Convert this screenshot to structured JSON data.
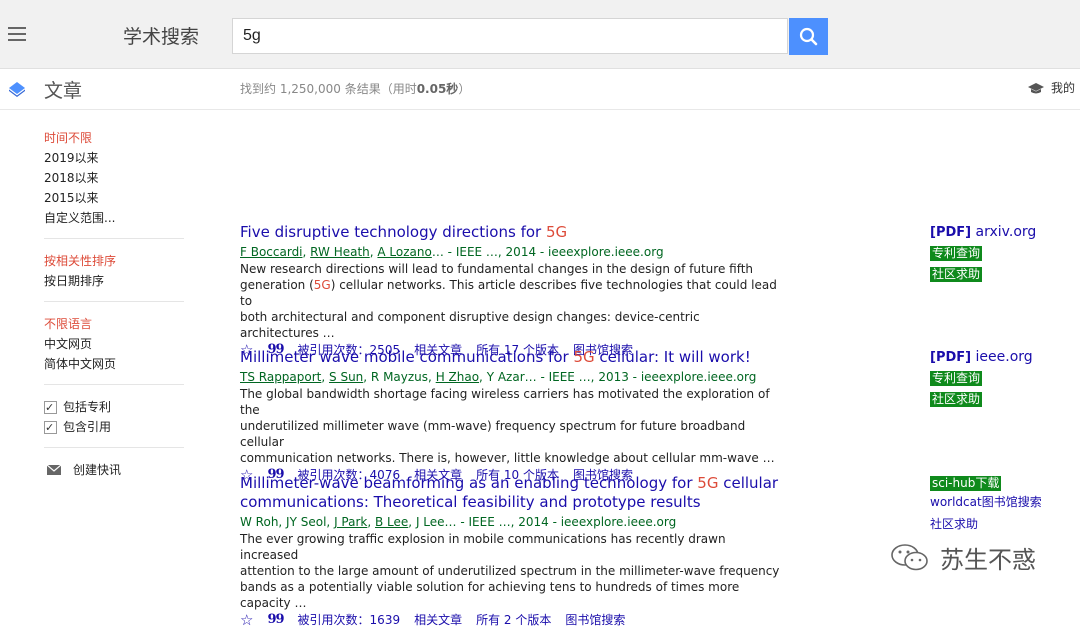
{
  "header": {
    "brand": "学术搜索",
    "search_value": "5g"
  },
  "subbar": {
    "section": "文章",
    "result_prefix": "找到约 1,250,000 条结果（用时",
    "result_time": "0.05秒",
    "result_suffix": "）",
    "my_library": "我的"
  },
  "sidebar": {
    "time": [
      "时间不限",
      "2019以来",
      "2018以来",
      "2015以来",
      "自定义范围..."
    ],
    "sort": [
      "按相关性排序",
      "按日期排序"
    ],
    "lang": [
      "不限语言",
      "中文网页",
      "简体中文网页"
    ],
    "checks": [
      "包括专利",
      "包含引用"
    ],
    "alert": "创建快讯"
  },
  "results": [
    {
      "title_pre": "Five disruptive technology directions for ",
      "title_hl": "5G",
      "title_post": "",
      "title_line2": "",
      "authors": [
        "F Boccardi",
        "RW Heath",
        "A Lozano"
      ],
      "meta_rest": "… - IEEE …, 2014 - ieeexplore.ieee.org",
      "snippet_1": "New research directions will lead to fundamental changes in the design of future fifth",
      "snippet_2_pre": "generation (",
      "snippet_2_hl": "5G",
      "snippet_2_post": ") cellular networks. This article describes five technologies that could lead to",
      "snippet_3": "both architectural and component disruptive design changes: device-centric architectures …",
      "cited": "被引用次数：2505",
      "related": "相关文章",
      "versions": "所有 17 个版本",
      "library": "图书馆搜索",
      "side_tag": "[PDF]",
      "side_domain": "arxiv.org",
      "side_green_1": "专利查询",
      "side_green_2": "社区求助"
    },
    {
      "title_pre": "Millimeter wave mobile communications for ",
      "title_hl": "5G",
      "title_post": " cellular: It will work!",
      "authors": [
        "TS Rappaport",
        "S Sun",
        "H Zhao"
      ],
      "meta_mid_1": "R Mayzus",
      "meta_rest": "Y Azar… - IEEE …, 2013 - ieeexplore.ieee.org",
      "snippet_1": "The global bandwidth shortage facing wireless carriers has motivated the exploration of the",
      "snippet_2": "underutilized millimeter wave (mm-wave) frequency spectrum for future broadband cellular",
      "snippet_3": "communication networks. There is, however, little knowledge about cellular mm-wave …",
      "cited": "被引用次数：4076",
      "related": "相关文章",
      "versions": "所有 10 个版本",
      "library": "图书馆搜索",
      "side_tag": "[PDF]",
      "side_domain": "ieee.org",
      "side_green_1": "专利查询",
      "side_green_2": "社区求助"
    },
    {
      "title_pre": "Millimeter-wave beamforming as an enabling technology for ",
      "title_hl": "5G",
      "title_post": " cellular",
      "title_line2": "communications: Theoretical feasibility and prototype results",
      "authors": [
        "J Park",
        "B Lee"
      ],
      "meta_pre": "W Roh, JY Seol,",
      "meta_rest": "J Lee… - IEEE …, 2014 - ieeexplore.ieee.org",
      "snippet_1": "The ever growing traffic explosion in mobile communications has recently drawn increased",
      "snippet_2": "attention to the large amount of underutilized spectrum in the millimeter-wave frequency",
      "snippet_3": "bands as a potentially viable solution for achieving tens to hundreds of times more capacity …",
      "cited": "被引用次数：1639",
      "related": "相关文章",
      "versions": "所有 2 个版本",
      "library": "图书馆搜索",
      "side_green_1": "sci-hub下载",
      "side_plain_1": "worldcat图书馆搜索",
      "side_plain_2": "社区求助"
    }
  ],
  "watermark": "苏生不惑",
  "colors": {
    "accent_blue": "#4d90fe",
    "link": "#1a0dab",
    "highlight": "#dd4b39",
    "meta_green": "#006621",
    "tag_green": "#0f8a1c"
  }
}
